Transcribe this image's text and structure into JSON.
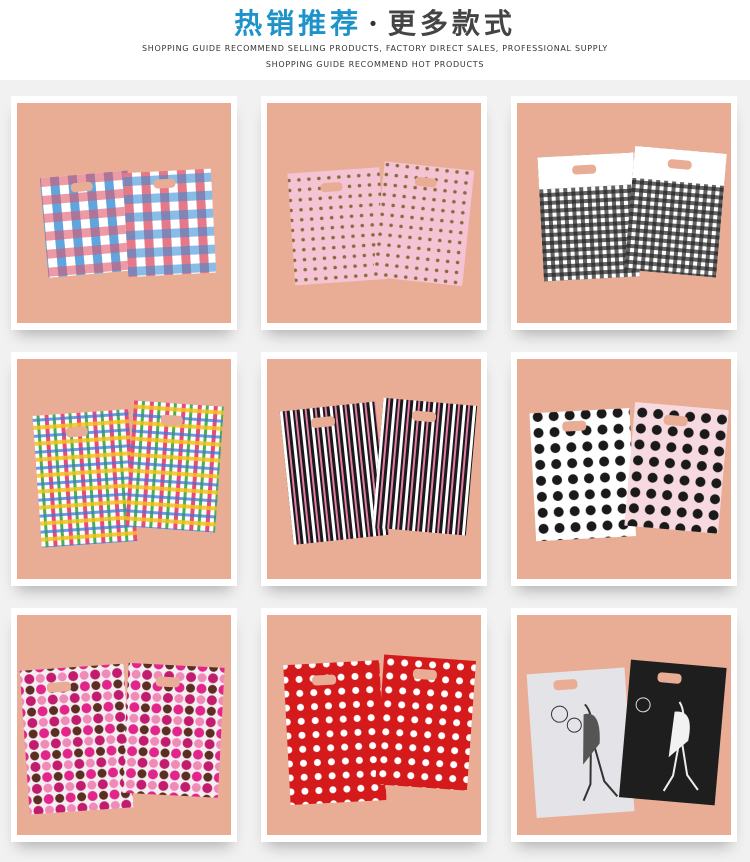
{
  "header": {
    "title_part1": "热销推荐",
    "title_dot": "·",
    "title_part2": "更多款式",
    "subtitle_line1": "SHOPPING GUIDE RECOMMEND SELLING PRODUCTS, FACTORY DIRECT SALES, PROFESSIONAL SUPPLY",
    "subtitle_line2": "SHOPPING GUIDE RECOMMEND HOT PRODUCTS"
  },
  "colors": {
    "accent": "#1d93c9",
    "background_band": "#f1f1f1",
    "photo_background": "#e9ad96"
  },
  "products": [
    {
      "pattern": "blue-red-plaid"
    },
    {
      "pattern": "pink-polka-dot"
    },
    {
      "pattern": "black-white-gingham"
    },
    {
      "pattern": "multicolor-plaid"
    },
    {
      "pattern": "black-pink-stripes"
    },
    {
      "pattern": "black-polka-dot"
    },
    {
      "pattern": "heart-circles"
    },
    {
      "pattern": "red-white-polka-dot"
    },
    {
      "pattern": "girl-with-balloons"
    }
  ]
}
